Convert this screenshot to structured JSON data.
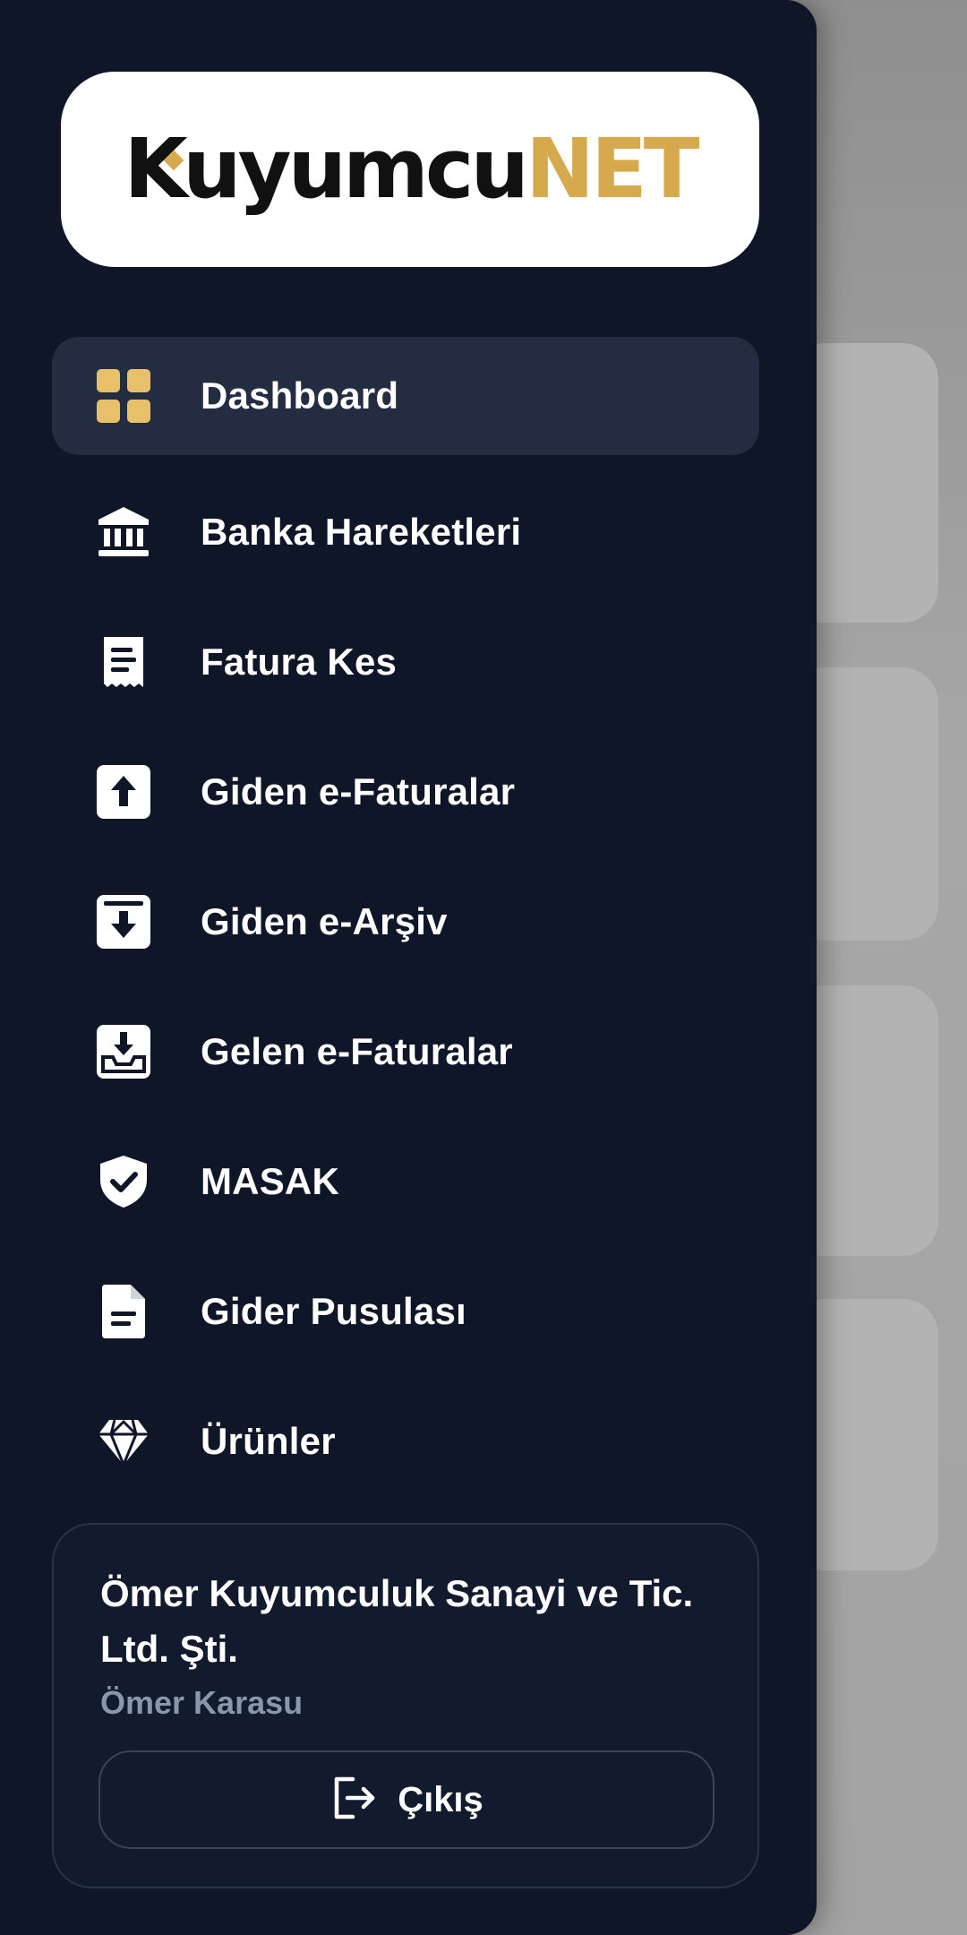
{
  "logo": {
    "part1": "Kuyumcu",
    "part2": "NET",
    "accent_color": "#d6a94c"
  },
  "sidebar": {
    "active_index": 0,
    "items": [
      {
        "label": "Dashboard",
        "icon": "grid-icon"
      },
      {
        "label": "Banka Hareketleri",
        "icon": "bank-icon"
      },
      {
        "label": "Fatura Kes",
        "icon": "receipt-icon"
      },
      {
        "label": "Giden e-Faturalar",
        "icon": "upload-box-icon"
      },
      {
        "label": "Giden e-Arşiv",
        "icon": "archive-icon"
      },
      {
        "label": "Gelen e-Faturalar",
        "icon": "inbox-download-icon"
      },
      {
        "label": "MASAK",
        "icon": "shield-check-icon"
      },
      {
        "label": "Gider Pusulası",
        "icon": "document-icon"
      },
      {
        "label": "Ürünler",
        "icon": "diamond-icon"
      }
    ]
  },
  "account": {
    "company": "Ömer Kuyumculuk Sanayi ve Tic. Ltd. Şti.",
    "user": "Ömer Karasu",
    "logout_label": "Çıkış",
    "logout_icon": "logout-icon"
  },
  "colors": {
    "drawer_bg": "#0e1628",
    "active_item_bg": "#232c40",
    "backdrop": "#9b9b9b"
  }
}
